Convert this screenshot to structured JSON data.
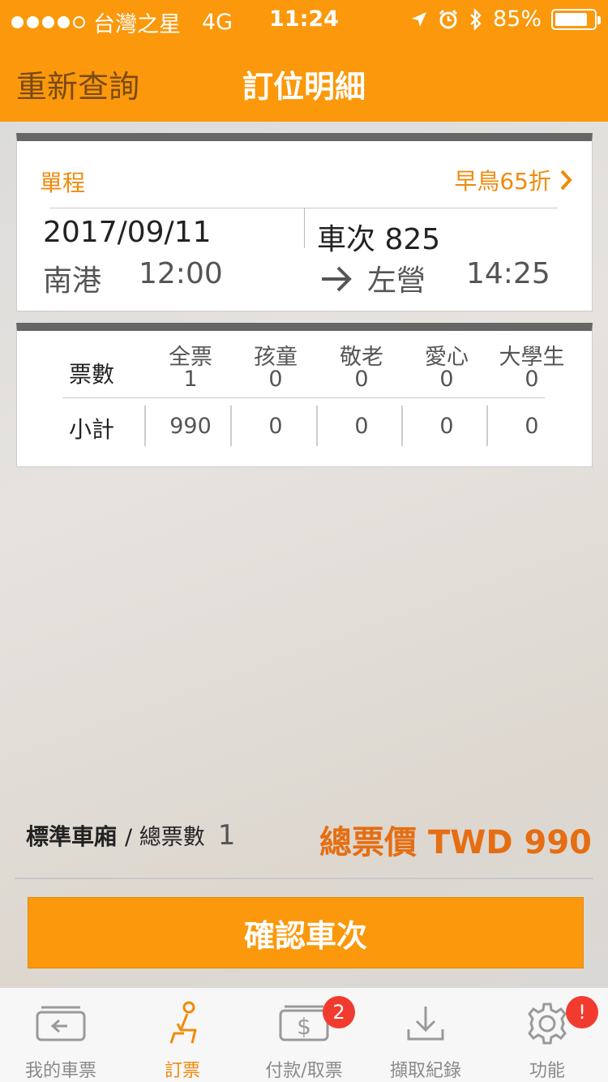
{
  "status_bar": {
    "carrier": "台灣之星",
    "network": "4G",
    "time": "11:24",
    "battery": "85%",
    "battery_level": 0.85
  },
  "nav": {
    "back_label": "重新查詢",
    "title": "訂位明細"
  },
  "trip": {
    "type": "單程",
    "promo": "早鳥65折",
    "date": "2017/09/11",
    "train": "車次 825",
    "from_station": "南港",
    "depart_time": "12:00",
    "to_station": "左營",
    "arrive_time": "14:25"
  },
  "tickets": {
    "count_label": "票數",
    "subtotal_label": "小計",
    "columns": [
      {
        "name": "全票",
        "count": "1",
        "subtotal": "990"
      },
      {
        "name": "孩童",
        "count": "0",
        "subtotal": "0"
      },
      {
        "name": "敬老",
        "count": "0",
        "subtotal": "0"
      },
      {
        "name": "愛心",
        "count": "0",
        "subtotal": "0"
      },
      {
        "name": "大學生",
        "count": "0",
        "subtotal": "0"
      }
    ]
  },
  "summary": {
    "car_type": "標準車廂",
    "count_label": "/ 總票數",
    "total_count": "1",
    "total_price": "總票價 TWD 990"
  },
  "confirm_label": "確認車次",
  "tabbar": {
    "items": [
      {
        "label": "我的車票",
        "icon": "ticket-icon"
      },
      {
        "label": "訂票",
        "icon": "seat-icon",
        "active": true
      },
      {
        "label": "付款/取票",
        "icon": "payment-icon",
        "badge": "2"
      },
      {
        "label": "擷取紀錄",
        "icon": "download-icon"
      },
      {
        "label": "功能",
        "icon": "gear-icon",
        "badge": "!"
      }
    ]
  },
  "colors": {
    "brand_orange": "#fb980b",
    "price_orange": "#e56e12",
    "badge_red": "#f23b2f"
  }
}
